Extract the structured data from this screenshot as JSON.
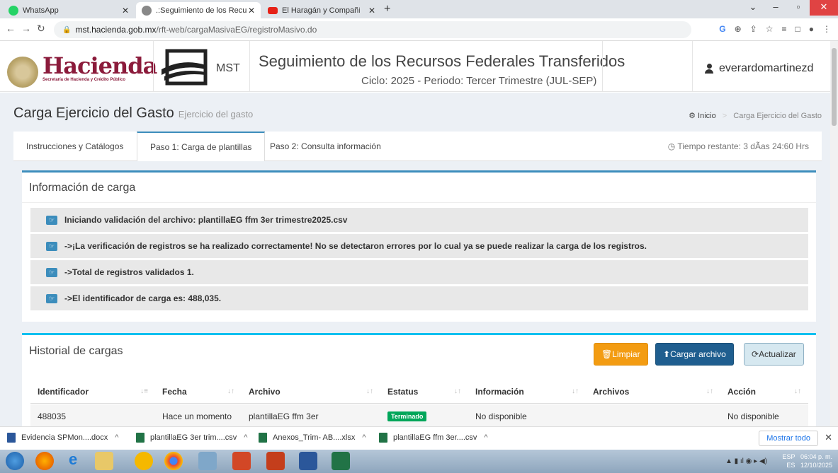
{
  "browser": {
    "tabs": [
      {
        "label": "WhatsApp",
        "color": "#25d366"
      },
      {
        "label": ".:Seguimiento de los Recursos Fe",
        "color": "#888888"
      },
      {
        "label": "El Haragán y Compañía - Mu",
        "color": "#e62117"
      }
    ],
    "url_host": "mst.hacienda.gob.mx",
    "url_path": "/rft-web/cargaMasivaEG/registroMasivo.do"
  },
  "header": {
    "logo_text": "Hacienda",
    "logo_sub": "Secretaría de Hacienda y Crédito Público",
    "mst_text": "MST",
    "title": "Seguimiento de los Recursos Federales Transferidos",
    "cycle": "Ciclo: 2025 - Periodo: Tercer Trimestre (JUL-SEP)",
    "user": "everardomartinezd"
  },
  "page": {
    "title": "Carga Ejercicio del Gasto",
    "subtitle": "Ejercicio del gasto",
    "breadcrumb_home": "Inicio",
    "breadcrumb_sep": ">",
    "breadcrumb_current": "Carga Ejercicio del Gasto"
  },
  "nav_tabs": {
    "tab1": "Instrucciones y Catálogos",
    "tab2": "Paso 1: Carga de plantillas",
    "tab3": "Paso 2: Consulta información",
    "timer": "Tiempo restante: 3 dÃas 24:60 Hrs"
  },
  "info": {
    "title": "Información de carga",
    "messages": [
      "Iniciando validación del archivo: plantillaEG ffm 3er trimestre2025.csv",
      "->¡La verificación de registros se ha realizado correctamente! No se detectaron errores por lo cual ya se puede realizar la carga de los registros.",
      "->Total de registros validados 1.",
      "->El identificador de carga es: 488,035."
    ]
  },
  "history": {
    "title": "Historial de cargas",
    "btn_clear": "Limpiar",
    "btn_upload": "Cargar archivo",
    "btn_refresh": "Actualizar",
    "columns": [
      "Identificador",
      "Fecha",
      "Archivo",
      "Estatus",
      "Información",
      "Archivos",
      "Acción"
    ],
    "row": {
      "id": "488035",
      "date": "Hace un momento",
      "file": "plantillaEG ffm 3er",
      "status": "Terminado",
      "info": "No disponible",
      "files": "",
      "action": "No disponible"
    }
  },
  "downloads": {
    "items": [
      "Evidencia SPMon....docx",
      "plantillaEG 3er trim....csv",
      "Anexos_Trim- AB....xlsx",
      "plantillaEG ffm 3er....csv"
    ],
    "show_all": "Mostrar todo"
  },
  "taskbar": {
    "lang": "ESP",
    "lang2": "ES",
    "time": "06:04 p. m.",
    "date": "12/10/2025"
  }
}
